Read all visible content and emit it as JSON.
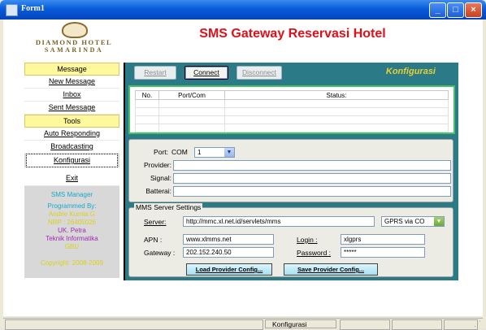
{
  "window": {
    "title": "Form1"
  },
  "app": {
    "logo_line1": "DIAMOND HOTEL",
    "logo_line2": "SAMARINDA",
    "title": "SMS Gateway Reservasi Hotel"
  },
  "sidebar": {
    "header_message": "Message",
    "new_message": "New Message",
    "inbox": "Inbox",
    "sent_message": "Sent Message",
    "header_tools": "Tools",
    "auto_responding": "Auto Responding",
    "broadcasting": "Broadcasting",
    "konfigurasi": "Konfigurasi",
    "exit": "Exit",
    "info": {
      "line1": "SMS Manager",
      "line2": "Programmed By:",
      "line3": "Andrie Kurnia G",
      "line4": "NRP : 26405026",
      "line5": "UK. Petra",
      "line6": "Teknik Informatika",
      "line7": "GBU",
      "line8": "Copyright: 2008-2009"
    }
  },
  "toolbar": {
    "restart": "Restart",
    "connect": "Connect",
    "disconnect": "Disconnect",
    "section_label": "Konfigurasi"
  },
  "status_table": {
    "columns": [
      "No.",
      "Port/Com",
      "Status:"
    ]
  },
  "modem": {
    "port_label": "Port:",
    "com_label": "COM",
    "port_value": "1",
    "provider_label": "Provider:",
    "signal_label": "Signal:",
    "batterai_label": "Batterai:"
  },
  "mms": {
    "legend": "MMS Server Settings",
    "server_label": "Server:",
    "server_value": "http://mmc.xl.net.id/servlets/mms",
    "mode_value": "GPRS via CO",
    "apn_label": "APN :",
    "apn_value": "www.xlmms.net",
    "login_label": "Login :",
    "login_value": "xlgprs",
    "gateway_label": "Gateway :",
    "gateway_value": "202.152.240.50",
    "password_label": "Password :",
    "password_value": "*****",
    "load_button": "Load Provider Config...",
    "save_button": "Save Provider Config..."
  },
  "statusbar": {
    "center": "Konfigurasi"
  },
  "colors": {
    "title_red": "#e0101a",
    "panel_teal": "#2a7a88",
    "accent_yellow": "#e8d030"
  }
}
